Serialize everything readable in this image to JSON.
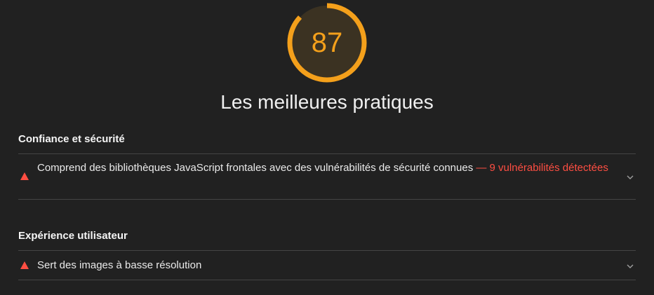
{
  "score": {
    "value": "87",
    "fraction": 0.87,
    "color": "#f4a01b",
    "track_color": "#3b3222"
  },
  "category": {
    "title": "Les meilleures pratiques"
  },
  "groups": [
    {
      "title": "Confiance et sécurité",
      "audits": [
        {
          "status": "fail",
          "icon": "triangle-warning-icon",
          "title": "Comprend des bibliothèques JavaScript frontales avec des vulnérabilités de sécurité connues",
          "separator": " — ",
          "display_value": "9 vulnérabilités détectées",
          "expand_icon": "chevron-down-icon"
        }
      ]
    },
    {
      "title": "Expérience utilisateur",
      "audits": [
        {
          "status": "fail",
          "icon": "triangle-warning-icon",
          "title": "Sert des images à basse résolution",
          "expand_icon": "chevron-down-icon"
        }
      ]
    }
  ],
  "colors": {
    "background": "#212121",
    "fail": "#ff4e42",
    "divider": "#454545"
  }
}
